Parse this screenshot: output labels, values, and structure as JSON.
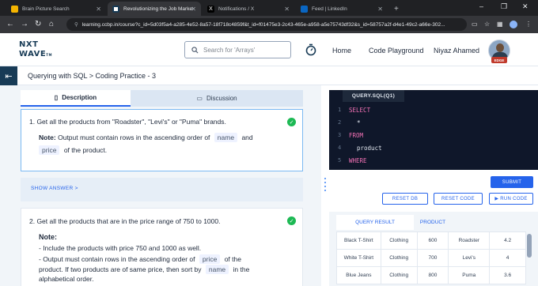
{
  "browser": {
    "tabs": [
      {
        "title": "Brain Picture Search",
        "active": false,
        "icon_color": "#f4b400"
      },
      {
        "title": "Revolutionizing the Job Market",
        "active": true,
        "icon_color": "#ffffff"
      },
      {
        "title": "Notifications / X",
        "active": false,
        "icon_color": "#000000"
      },
      {
        "title": "Feed | LinkedIn",
        "active": false,
        "icon_color": "#0a66c2"
      }
    ],
    "new_tab": "+",
    "url": "learning.ccbp.in/course?c_id=5d03f5a4-a285-4e52-8a57-18f718c4859f&t_id=f01475e3-2c43-465e-a958-a5e75743df32&s_id=58757a2f-d4e1-49c2-a66e-302..."
  },
  "header": {
    "logo_line1": "NXT",
    "logo_line2": "WAVE",
    "logo_tm": "TM",
    "search_placeholder": "Search for 'Arrays'",
    "nav": [
      "Home",
      "Code Playground"
    ],
    "user_name": "Niyaz Ahamed",
    "avatar_badge": "EDGE"
  },
  "breadcrumb": "Querying with SQL > Coding Practice - 3",
  "left": {
    "tabs": [
      "Description",
      "Discussion"
    ],
    "q1": {
      "text": "1. Get all the products from \"Roadster\", \"Levi's\" or \"Puma\" brands.",
      "note_label": "Note:",
      "note_pre": "Output must contain rows in the ascending order of",
      "note_code1": "name",
      "note_mid": "and",
      "note_code2": "price",
      "note_post": "of the product."
    },
    "show_answer": "SHOW ANSWER >",
    "q2": {
      "text": "2. Get all the products that are in the price range of 750 to 1000.",
      "note_label": "Note:",
      "bullet1": "- Include the products with price 750 and 1000 as well.",
      "bullet2_pre": "- Output must contain rows in the ascending order of",
      "bullet2_code": "price",
      "bullet2_post": "of the",
      "line3_pre": "product. If two products are of same price, then sort by",
      "line3_code": "name",
      "line3_post": "in the",
      "line4": "alphabetical order."
    }
  },
  "editor": {
    "file_tab": "QUERY.SQL(Q1)",
    "lines": [
      {
        "num": "1",
        "text": "SELECT",
        "kind": "kw",
        "indent": 0
      },
      {
        "num": "2",
        "text": "*",
        "kind": "id",
        "indent": 1
      },
      {
        "num": "3",
        "text": "FROM",
        "kind": "kw",
        "indent": 0
      },
      {
        "num": "4",
        "text": "product",
        "kind": "id",
        "indent": 1
      },
      {
        "num": "5",
        "text": "WHERE",
        "kind": "kw",
        "indent": 0
      }
    ]
  },
  "buttons": {
    "submit": "SUBMIT",
    "reset_db": "RESET DB",
    "reset_code": "RESET CODE",
    "run_code": "▶ RUN CODE"
  },
  "results": {
    "tabs": [
      "QUERY RESULT",
      "PRODUCT"
    ],
    "rows": [
      [
        "Black T-Shirt",
        "Clothing",
        "600",
        "Roadster",
        "4.2"
      ],
      [
        "White T-Shirt",
        "Clothing",
        "700",
        "Levi's",
        "4"
      ],
      [
        "Blue Jeans",
        "Clothing",
        "800",
        "Puma",
        "3.6"
      ]
    ]
  },
  "colors": {
    "brand_dark": "#183b56",
    "accent_blue": "#2563eb",
    "success": "#1db954",
    "editor_bg": "#0f172a"
  }
}
